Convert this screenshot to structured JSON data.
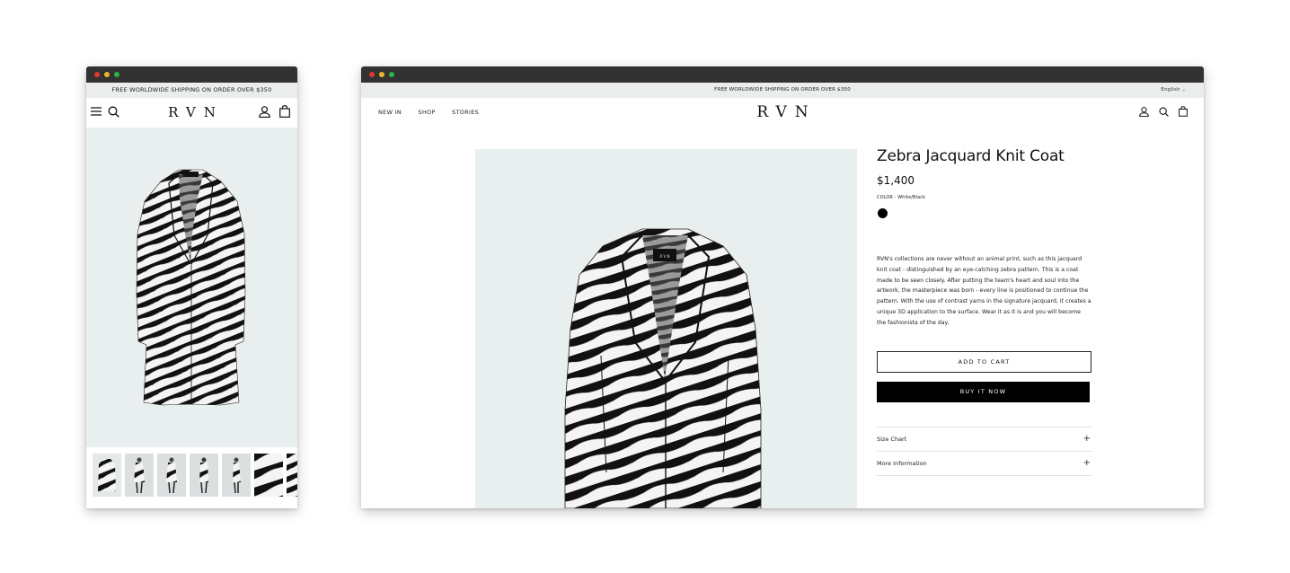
{
  "mobile": {
    "announcement": "FREE WORLDWIDE SHIPPING ON ORDER OVER $350",
    "logo": "RVN",
    "icons": [
      "menu-icon",
      "search-icon",
      "account-icon",
      "bag-icon"
    ],
    "thumbnail_count": 7
  },
  "desktop": {
    "announcement": "FREE WORLDWIDE SHIPPING ON ORDER OVER $350",
    "language": "English",
    "nav": [
      "NEW IN",
      "SHOP",
      "STORIES"
    ],
    "logo": "RVN",
    "icons": [
      "account-icon",
      "search-icon",
      "bag-icon"
    ],
    "product": {
      "title": "Zebra Jacquard Knit Coat",
      "price": "$1,400",
      "color_label": "COLOR - White/Black",
      "swatch_color": "#000000",
      "description": "RVN's collections are never without an animal print, such as this jacquard knit coat - distinguished by an eye-catching zebra pattern. This is a coat made to be seen closely. After putting the team's heart and soul into the artwork, the masterpiece was born - every line is positioned to continue the pattern. With the use of contrast yarns in the signature jacquard, it creates a unique 3D application to the surface. Wear it as it is and you will become the fashionista of the day.",
      "add_to_cart": "ADD TO CART",
      "buy_now": "BUY IT NOW",
      "accordions": [
        "Size Chart",
        "More Information"
      ]
    }
  },
  "colors": {
    "titlebar": "#323232",
    "announcement_bg": "#ebeded",
    "hero_bg": "#e9efee",
    "primary_button": "#000000"
  }
}
